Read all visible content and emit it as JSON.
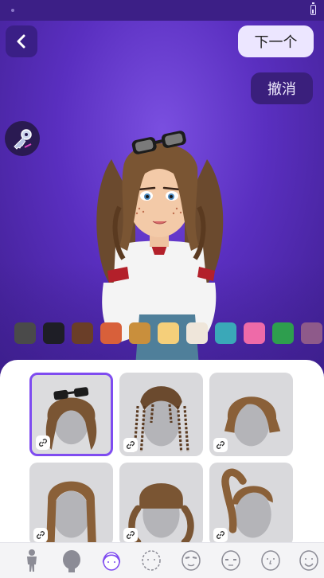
{
  "header": {
    "next_label": "下一个",
    "undo_label": "撤消"
  },
  "palette": {
    "colors": [
      "#4a4a4a",
      "#1e1e26",
      "#6a3e28",
      "#d8603a",
      "#c98f3c",
      "#f5cf7a",
      "#efe6da",
      "#3aa8b8",
      "#ee6aa8",
      "#2e9e4e",
      "#8e5a8a"
    ]
  },
  "accent_color": "#7f4cf0",
  "hair_options": [
    {
      "style": "curly-with-glasses",
      "selected": true
    },
    {
      "style": "braids",
      "selected": false
    },
    {
      "style": "short-bob",
      "selected": false
    },
    {
      "style": "long-straight",
      "selected": false
    },
    {
      "style": "bangs-pigtails",
      "selected": false
    },
    {
      "style": "ponytail",
      "selected": false
    }
  ],
  "tabs": [
    {
      "icon": "body-icon",
      "active": false
    },
    {
      "icon": "head-icon",
      "active": false
    },
    {
      "icon": "hair-icon",
      "active": true
    },
    {
      "icon": "face-shape-icon",
      "active": false
    },
    {
      "icon": "eyebrows-icon",
      "active": false
    },
    {
      "icon": "eyes-icon",
      "active": false
    },
    {
      "icon": "nose-icon",
      "active": false
    },
    {
      "icon": "mouth-icon",
      "active": false
    }
  ]
}
